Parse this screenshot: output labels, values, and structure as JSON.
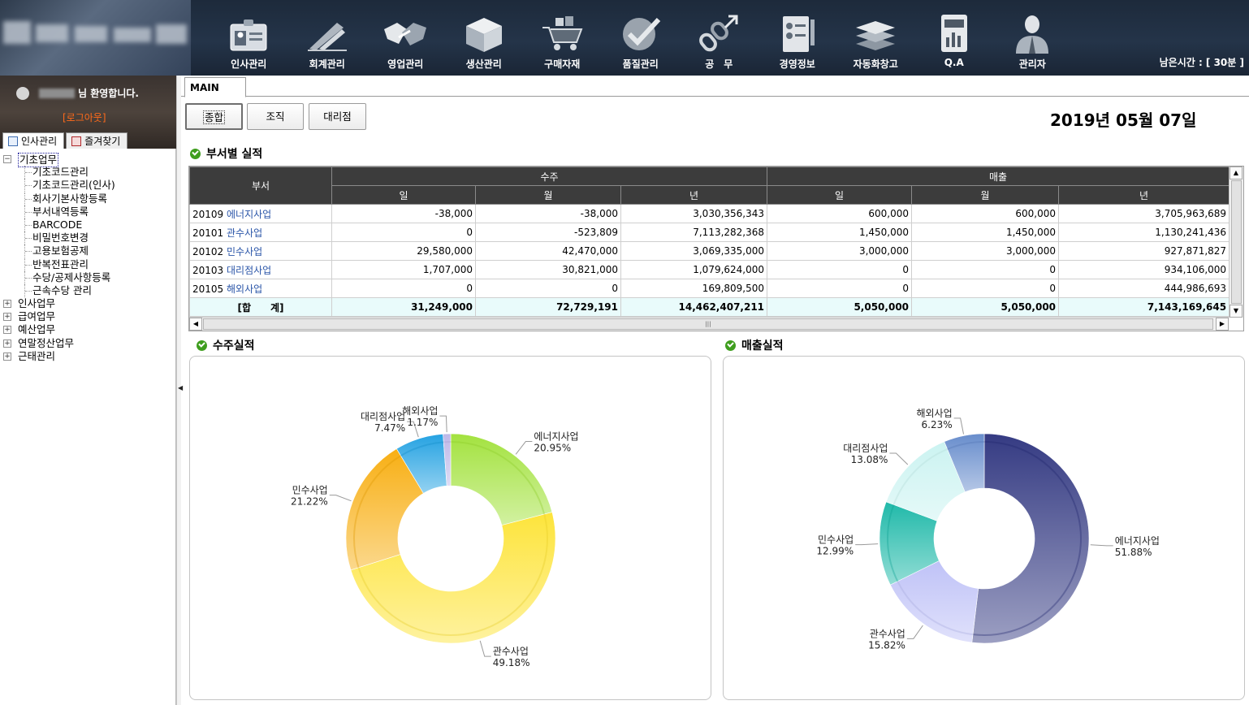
{
  "header": {
    "menu": [
      {
        "label": "인사관리",
        "icon": "id-card-icon"
      },
      {
        "label": "회계관리",
        "icon": "pen-icon"
      },
      {
        "label": "영업관리",
        "icon": "handshake-icon"
      },
      {
        "label": "생산관리",
        "icon": "box-icon"
      },
      {
        "label": "구매자재",
        "icon": "cart-icon"
      },
      {
        "label": "품질관리",
        "icon": "checkmark-icon"
      },
      {
        "label": "공　무",
        "icon": "link-arrow-icon"
      },
      {
        "label": "경영정보",
        "icon": "checklist-icon"
      },
      {
        "label": "자동화창고",
        "icon": "layers-icon"
      },
      {
        "label": "Q.A",
        "icon": "report-icon"
      },
      {
        "label": "관리자",
        "icon": "admin-person-icon"
      }
    ],
    "remaining_time": "남은시간 : [ 30분 ]"
  },
  "sidebar": {
    "welcome": "님 환영합니다.",
    "logout": "[로그아웃]",
    "tabs": [
      {
        "label": "인사관리",
        "icon": "tree-list-icon"
      },
      {
        "label": "즐겨찾기",
        "icon": "bookmark-icon"
      }
    ],
    "tree": [
      {
        "label": "기초업무",
        "expanded": true,
        "children": [
          "기초코드관리",
          "기초코드관리(인사)",
          "회사기본사항등록",
          "부서내역등록",
          "BARCODE",
          "비밀번호변경",
          "고용보험공제",
          "반복전표관리",
          "수당/공제사항등록",
          "근속수당 관리"
        ]
      },
      {
        "label": "인사업무",
        "expanded": false,
        "children": []
      },
      {
        "label": "급여업무",
        "expanded": false,
        "children": []
      },
      {
        "label": "예산업무",
        "expanded": false,
        "children": []
      },
      {
        "label": "연말정산업무",
        "expanded": false,
        "children": []
      },
      {
        "label": "근태관리",
        "expanded": false,
        "children": []
      }
    ]
  },
  "main": {
    "tab": "MAIN",
    "buttons": {
      "total": "종합",
      "org": "조직",
      "agent": "대리점"
    },
    "date": "2019년 05월 07일",
    "section_table": "부서별 실적",
    "section_orders": "수주실적",
    "section_sales": "매출실적",
    "table": {
      "dept_header": "부서",
      "group_headers": [
        "수주",
        "매출"
      ],
      "sub_headers": [
        "일",
        "월",
        "년",
        "일",
        "월",
        "년"
      ],
      "rows": [
        {
          "code": "20109",
          "name": "에너지사업",
          "values": [
            "-38,000",
            "-38,000",
            "3,030,356,343",
            "600,000",
            "600,000",
            "3,705,963,689"
          ]
        },
        {
          "code": "20101",
          "name": "관수사업",
          "values": [
            "0",
            "-523,809",
            "7,113,282,368",
            "1,450,000",
            "1,450,000",
            "1,130,241,436"
          ]
        },
        {
          "code": "20102",
          "name": "민수사업",
          "values": [
            "29,580,000",
            "42,470,000",
            "3,069,335,000",
            "3,000,000",
            "3,000,000",
            "927,871,827"
          ]
        },
        {
          "code": "20103",
          "name": "대리점사업",
          "values": [
            "1,707,000",
            "30,821,000",
            "1,079,624,000",
            "0",
            "0",
            "934,106,000"
          ]
        },
        {
          "code": "20105",
          "name": "해외사업",
          "values": [
            "0",
            "0",
            "169,809,500",
            "0",
            "0",
            "444,986,693"
          ]
        }
      ],
      "total_label": "[합　　계]",
      "total_values": [
        "31,249,000",
        "72,729,191",
        "14,462,407,211",
        "5,050,000",
        "5,050,000",
        "7,143,169,645"
      ]
    }
  },
  "chart_data": [
    {
      "type": "pie",
      "categories": [
        "에너지사업",
        "관수사업",
        "민수사업",
        "대리점사업",
        "해외사업"
      ],
      "values": [
        20.95,
        49.18,
        21.22,
        7.47,
        1.17
      ],
      "labels": [
        "20.95%",
        "49.18%",
        "21.22%",
        "7.47%",
        "1.17%"
      ],
      "colors": [
        "#9be02e",
        "#fde22a",
        "#f7a800",
        "#129adf",
        "#b7b2e6"
      ]
    },
    {
      "type": "pie",
      "categories": [
        "에너지사업",
        "관수사업",
        "민수사업",
        "대리점사업",
        "해외사업"
      ],
      "values": [
        51.88,
        15.82,
        12.99,
        13.08,
        6.23
      ],
      "labels": [
        "51.88%",
        "15.82%",
        "12.99%",
        "13.08%",
        "6.23%"
      ],
      "colors": [
        "#232a78",
        "#b9bdf6",
        "#0db3a2",
        "#c6f2f0",
        "#5b83c8"
      ]
    }
  ]
}
